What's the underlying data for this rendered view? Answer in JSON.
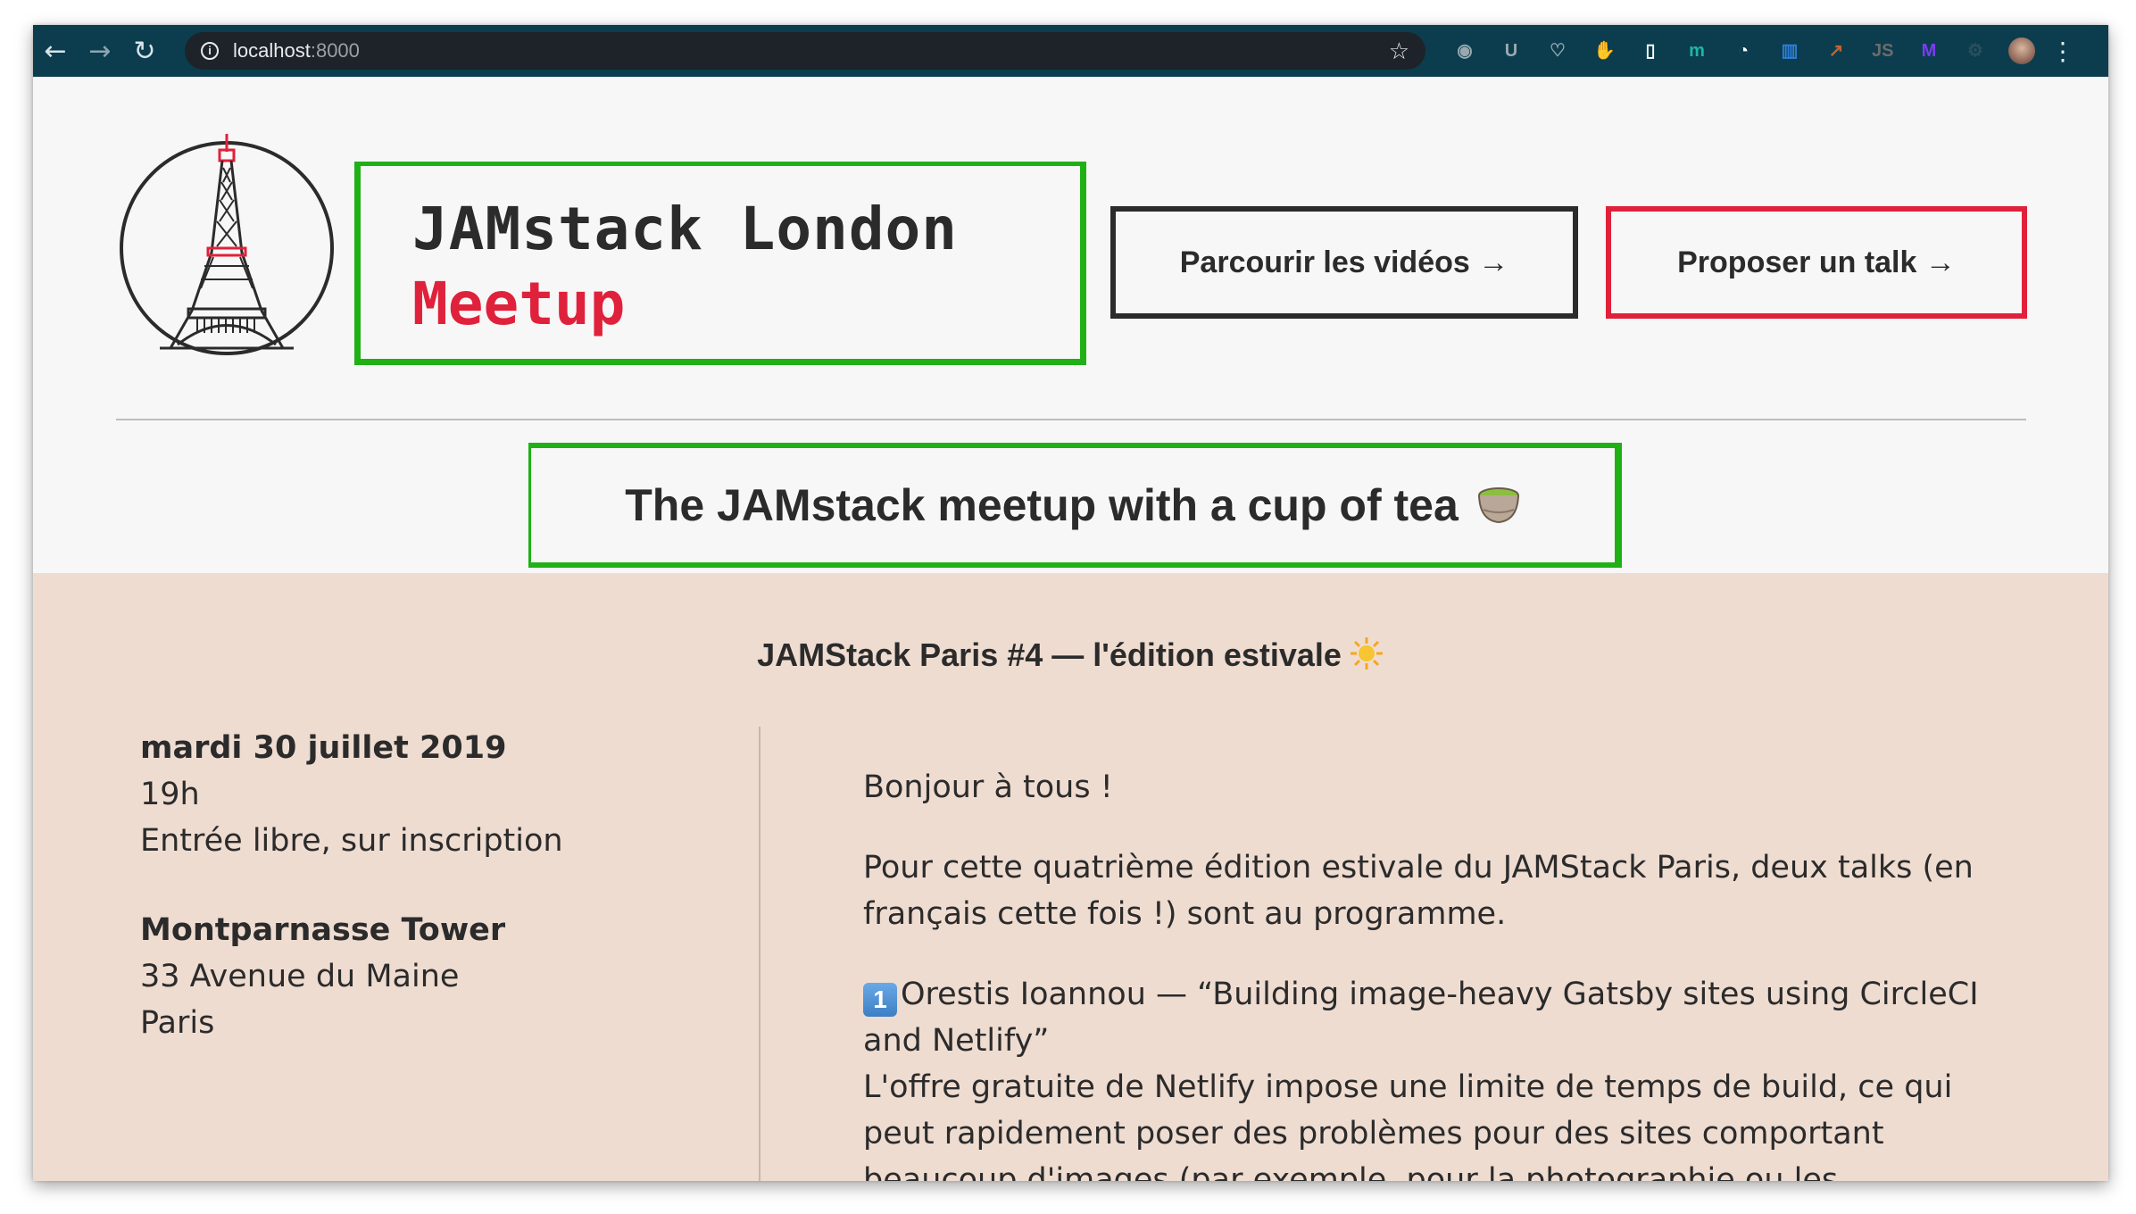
{
  "browser": {
    "url_host": "localhost",
    "url_port": ":8000",
    "extensions": [
      {
        "name": "camera-ext-icon",
        "color": "#9aa9b0",
        "glyph": "◉"
      },
      {
        "name": "ublock-ext-icon",
        "color": "#9aa9b0",
        "glyph": "U"
      },
      {
        "name": "pocket-ext-icon",
        "color": "#9aa9b0",
        "glyph": "♡"
      },
      {
        "name": "hand-ext-icon",
        "color": "#ffffff",
        "glyph": "✋"
      },
      {
        "name": "document-ext-icon",
        "color": "#ffffff",
        "glyph": "▯"
      },
      {
        "name": "mercury-ext-icon",
        "color": "#1fb5a4",
        "glyph": "m"
      },
      {
        "name": "clock-ext-icon",
        "color": "#ffffff",
        "glyph": "◔"
      },
      {
        "name": "trello-ext-icon",
        "color": "#2d7ed8",
        "glyph": "▥"
      },
      {
        "name": "color-ext-icon",
        "color": "#c7612f",
        "glyph": "↗"
      },
      {
        "name": "js-ext-icon",
        "color": "#6c6c6c",
        "glyph": "JS"
      },
      {
        "name": "m-ext-icon",
        "color": "#7a3df0",
        "glyph": "M"
      },
      {
        "name": "settings-ext-icon",
        "color": "#2a4f5c",
        "glyph": "⚙"
      }
    ]
  },
  "header": {
    "title_line1": "JAMstack London",
    "title_line2": "Meetup",
    "videos_button": "Parcourir les vidéos →",
    "talk_button": "Proposer un talk →",
    "tagline": "The JAMstack meetup with a cup of tea"
  },
  "event": {
    "title": "JAMStack Paris #4 — l'édition estivale",
    "date": "mardi 30 juillet 2019",
    "time": "19h",
    "entry": "Entrée libre, sur inscription",
    "venue_name": "Montparnasse Tower",
    "venue_street": "33 Avenue du Maine",
    "venue_city": "Paris",
    "greeting": "Bonjour à tous !",
    "intro": "Pour cette quatrième édition estivale du JAMStack Paris, deux talks (en français cette fois !) sont au programme.",
    "talk1_number": "1",
    "talk1_title": "Orestis Ioannou — “Building image-heavy Gatsby sites using CircleCI and Netlify”",
    "talk1_desc": "L'offre gratuite de Netlify impose une limite de temps de build, ce qui peut rapidement poser des problèmes pour des sites comportant beaucoup d'images (par exemple, pour la photographie ou les"
  },
  "colors": {
    "chrome_bg": "#0b3d4e",
    "page_bg": "#f7f7f7",
    "event_bg": "#efdcd1",
    "accent_green": "#1fb016",
    "accent_red": "#e0213b",
    "text_dark": "#2b2b2b"
  }
}
